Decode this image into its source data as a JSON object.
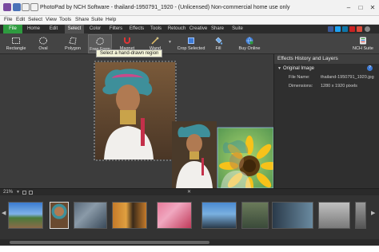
{
  "titlebar": {
    "title": "PhotoPad by NCH Software - thailand-1950791_1920 - (Unlicensed) Non-commercial home use only",
    "minimize": "–",
    "maximize": "□",
    "close": "✕"
  },
  "menubar": {
    "items": [
      "File",
      "Edit",
      "Select",
      "View",
      "Tools",
      "Share",
      "Suite",
      "Help"
    ]
  },
  "tabs": {
    "items": [
      "File",
      "Home",
      "Edit",
      "Select",
      "Color",
      "Filters",
      "Effects",
      "Tools",
      "Retouch",
      "Creative",
      "Share",
      "Suite"
    ],
    "active": "Select"
  },
  "toolbar": {
    "tools": [
      "Rectangle",
      "Oval",
      "Polygon",
      "Free Form",
      "Magnet",
      "Wand",
      "Crop Selected",
      "Fill",
      "Buy Online",
      "NCH Suite"
    ],
    "active_tool": "Free Form"
  },
  "tooltip": {
    "text": "Select a hand-drawn region"
  },
  "panel": {
    "title": "Effects History and Layers",
    "section": "Original Image",
    "file_name_label": "File Name:",
    "file_name_value": "thailand-1950791_1920.jpg",
    "dimensions_label": "Dimensions:",
    "dimensions_value": "1280 x 1920 pixels",
    "help": "?"
  },
  "status": {
    "zoom": "21%"
  },
  "colors": {
    "file_tab": "#2e9b3f",
    "accent_blue": "#3d7bd6",
    "toolbar_bg": "#444444",
    "canvas_bg": "#3c3c3c"
  }
}
